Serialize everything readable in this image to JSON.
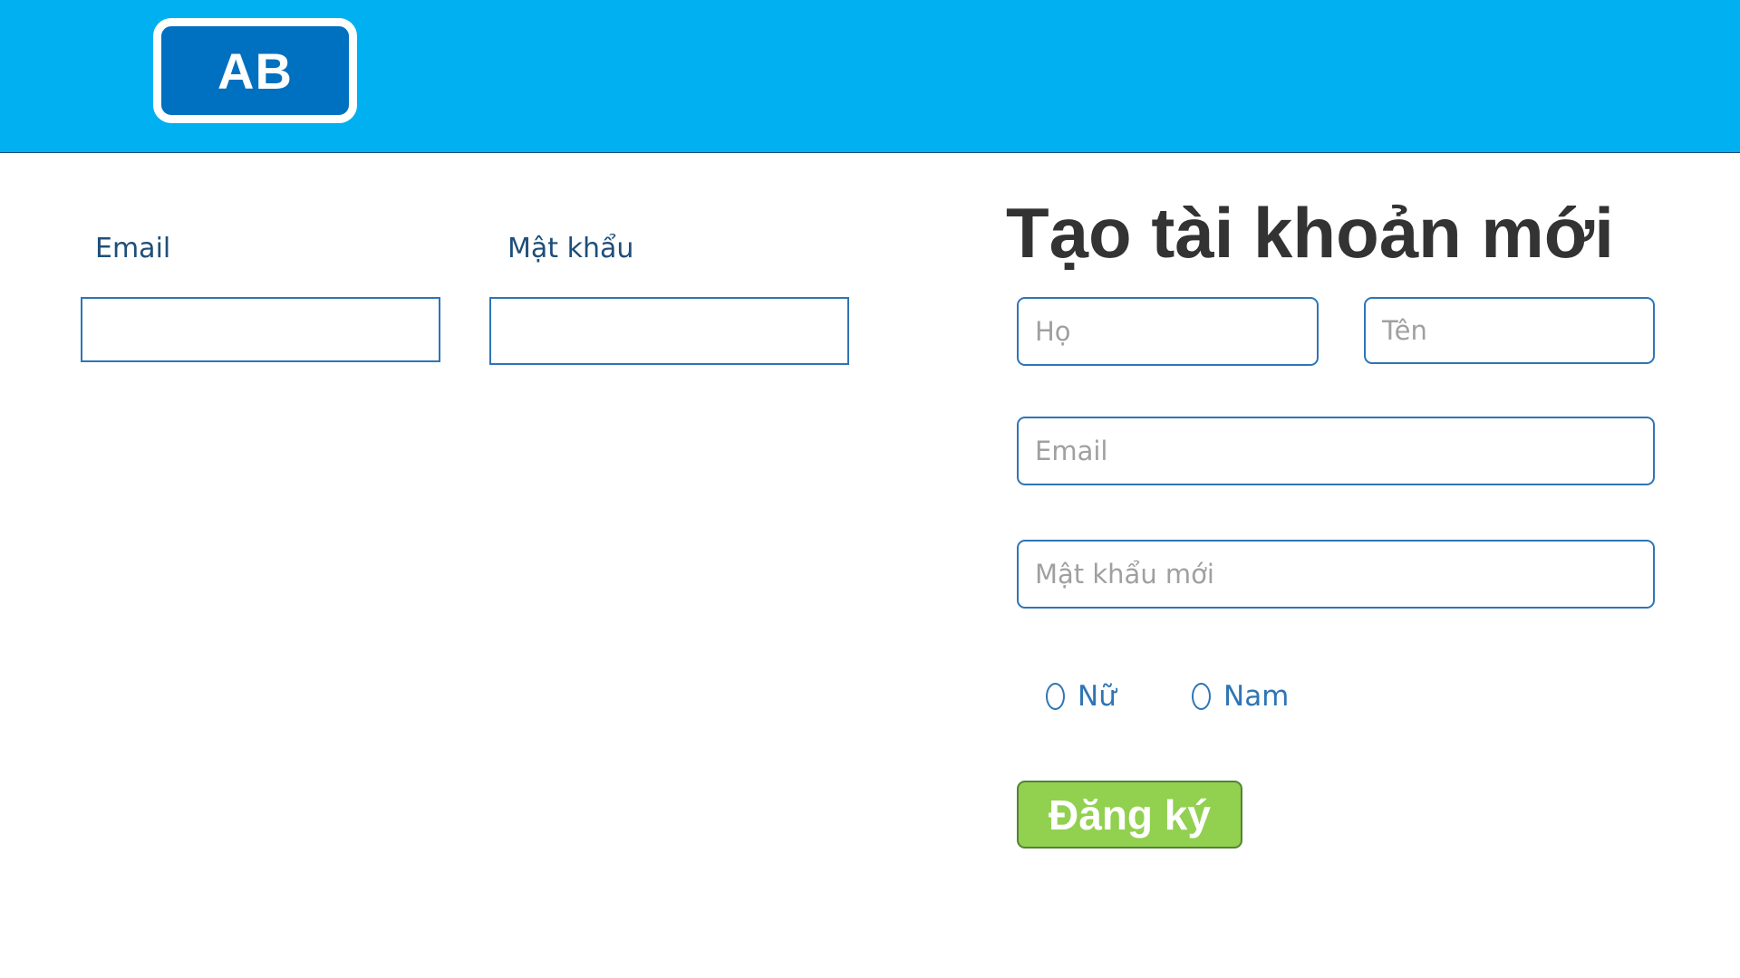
{
  "header": {
    "logo_text": "AB",
    "background_color": "#00b0f0",
    "logo_color": "#0070c0"
  },
  "login": {
    "email_label": "Email",
    "password_label": "Mật khẩu",
    "email_value": "",
    "password_value": ""
  },
  "register": {
    "title": "Tạo tài khoản mới",
    "last_name_placeholder": "Họ",
    "first_name_placeholder": "Tên",
    "email_placeholder": "Email",
    "new_password_placeholder": "Mật khẩu mới",
    "gender_options": [
      {
        "label": "Nữ",
        "selected": false
      },
      {
        "label": "Nam",
        "selected": false
      }
    ],
    "submit_label": "Đăng ký",
    "submit_color": "#92d050"
  }
}
